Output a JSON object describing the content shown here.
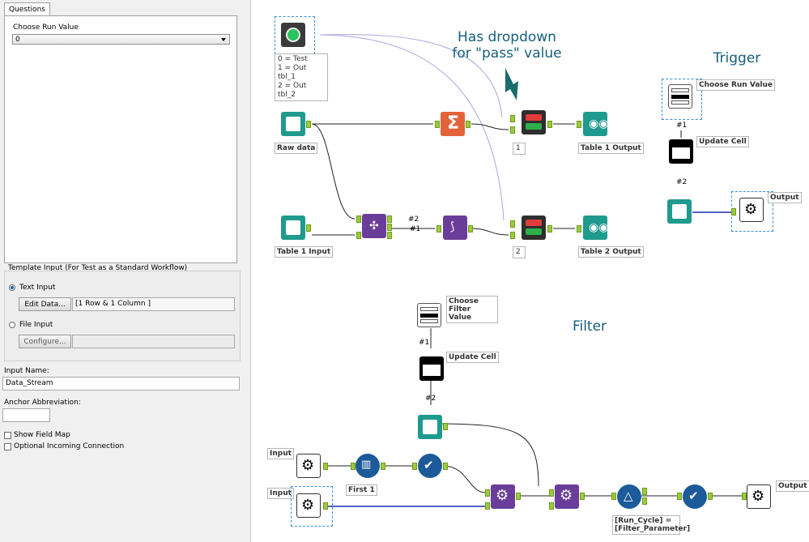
{
  "left_panel": {
    "tab_label": "Questions",
    "question_label": "Choose Run Value",
    "question_value": "0",
    "template_group_title": "Template Input (For Test as a Standard Workflow)",
    "text_input_label": "Text Input",
    "edit_data_button": "Edit Data...",
    "data_summary": "[1 Row & 1 Column ]",
    "file_input_label": "File Input",
    "configure_button": "Configure...",
    "input_name_label": "Input Name:",
    "input_name_value": "Data_Stream",
    "anchor_label": "Anchor Abbreviation:",
    "anchor_value": "",
    "show_field_map_label": "Show Field Map",
    "optional_incoming_label": "Optional Incoming Connection"
  },
  "canvas": {
    "annotation_dropdown_line1": "Has dropdown",
    "annotation_dropdown_line2": "for \"pass\" value",
    "annotation_trigger": "Trigger",
    "annotation_filter": "Filter",
    "cond_cap_lines": [
      "0 = Test",
      "1 = Out tbl_1",
      "2 = Out tbl_2"
    ],
    "raw_data_cap": "Raw data",
    "table1_input_cap": "Table 1 Input",
    "table1_output_cap": "Table 1 Output",
    "table2_output_cap": "Table 2 Output",
    "select_num_1": "1",
    "select_num_2": "2",
    "trigger_choose_cap": "Choose Run Value",
    "trigger_update_cap": "Update Cell",
    "trigger_output_cap": "Output",
    "filter_choose_cap": "Choose Filter Value",
    "filter_update_cap": "Update Cell",
    "filter_input1_cap": "Input",
    "filter_input2_cap": "Input",
    "first_cap": "First 1",
    "filter_formula_cap": "[Run_Cycle] = [Filter_Parameter]",
    "filter_output_cap": "Output",
    "conn_2": "#2",
    "conn_1": "#1",
    "trig_conn_1": "#1",
    "trig_conn_2": "#2",
    "filt_conn_1": "#1",
    "filt_conn_2": "#2"
  },
  "colors": {
    "book_teal": "#1f9a8e",
    "summarize_orange": "#e2623a",
    "purple": "#6a3d9a",
    "blue_tool": "#1c5a99",
    "annotation_text": "#17607a"
  }
}
